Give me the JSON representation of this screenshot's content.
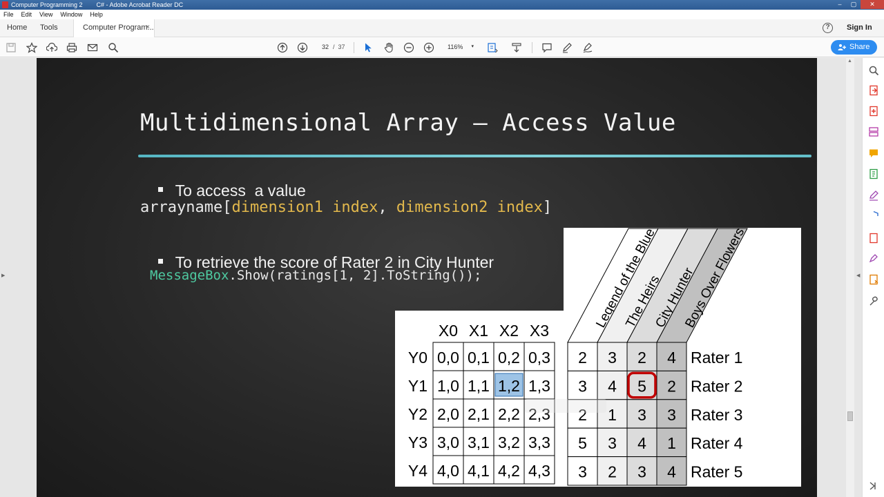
{
  "window": {
    "title": "Computer Programming 2        C# - Adobe Acrobat Reader DC",
    "controls": [
      "–",
      "▢",
      "✕"
    ]
  },
  "menu": [
    "File",
    "Edit",
    "View",
    "Window",
    "Help"
  ],
  "tabs": {
    "home": "Home",
    "tools": "Tools",
    "document": "Computer Program...",
    "close": "×",
    "help": "?",
    "signin": "Sign In"
  },
  "toolbar": {
    "page_current": "32",
    "page_total": "/  37",
    "zoom": "116%",
    "zoom_caret": "▾",
    "share_label": "Share"
  },
  "slide": {
    "title": "Multidimensional Array – Access Value",
    "bullet1": "To access  a value",
    "syntax": {
      "name": "arrayname",
      "open": "[",
      "param1": "dimension1 index",
      "comma": ", ",
      "param2": "dimension2 index",
      "close": "]"
    },
    "bullet2": "To retrieve the score of Rater 2 in City Hunter",
    "code": {
      "class_name": "MessageBox",
      "rest": ".Show(ratings[1, 2].ToString());"
    }
  },
  "figure": {
    "index_col_headers": [
      "X0",
      "X1",
      "X2",
      "X3"
    ],
    "index_row_headers": [
      "Y0",
      "Y1",
      "Y2",
      "Y3",
      "Y4"
    ],
    "index_cells": [
      [
        "0,0",
        "0,1",
        "0,2",
        "0,3"
      ],
      [
        "1,0",
        "1,1",
        "1,2",
        "1,3"
      ],
      [
        "2,0",
        "2,1",
        "2,2",
        "2,3"
      ],
      [
        "3,0",
        "3,1",
        "3,2",
        "3,3"
      ],
      [
        "4,0",
        "4,1",
        "4,2",
        "4,3"
      ]
    ],
    "highlighted_index": [
      1,
      2
    ],
    "show_titles": [
      "Legend of the Blue Sea",
      "The Heirs",
      "City Hunter",
      "Boys Over Flowers"
    ],
    "ratings": [
      [
        "2",
        "3",
        "2",
        "4"
      ],
      [
        "3",
        "4",
        "5",
        "2"
      ],
      [
        "2",
        "1",
        "3",
        "3"
      ],
      [
        "5",
        "3",
        "4",
        "1"
      ],
      [
        "3",
        "2",
        "3",
        "4"
      ]
    ],
    "raters": [
      "Rater 1",
      "Rater 2",
      "Rater 3",
      "Rater 4",
      "Rater 5"
    ],
    "colors": {
      "highlight_fill": "#9dc3e6",
      "circle": "#c00000",
      "col_shade": [
        "#ffffff",
        "#f0f0f0",
        "#dcdcdc",
        "#c0c0c0"
      ]
    }
  },
  "rail_icons": [
    "zoom-search-icon",
    "export-pdf-icon",
    "create-pdf-icon",
    "organize-pages-icon",
    "comment-icon",
    "edit-pdf-icon",
    "fill-sign-icon",
    "protect-icon",
    "send-pdf-icon",
    "sign-icon",
    "send-track-icon",
    "more-tools-icon",
    "expand-icon"
  ]
}
